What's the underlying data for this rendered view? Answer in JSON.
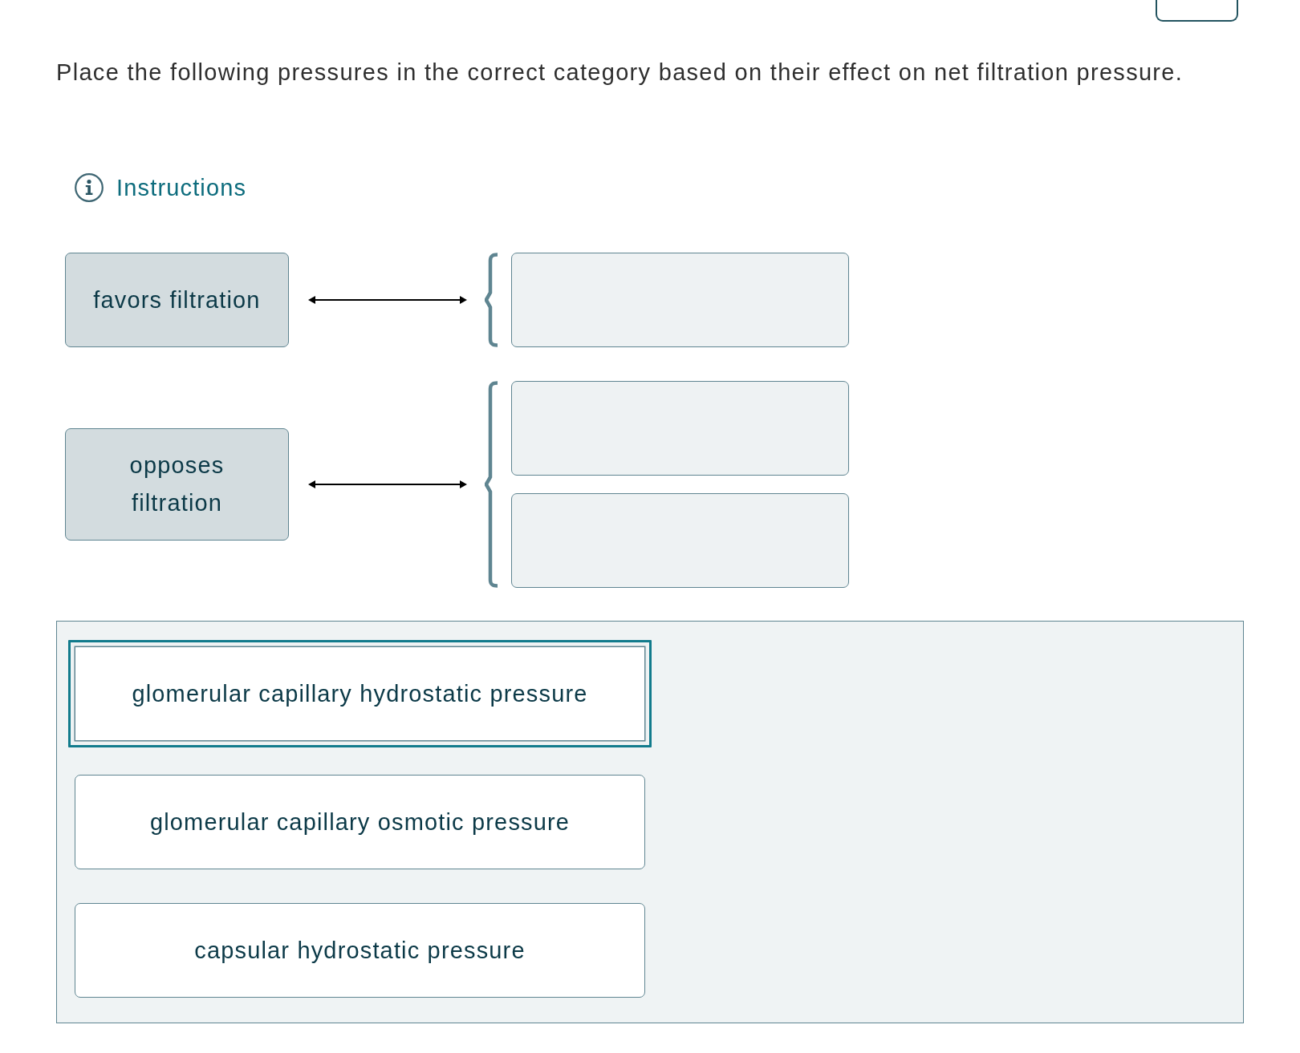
{
  "header": {
    "prompt": "Place the following pressures in the correct category based on their effect on net filtration pressure."
  },
  "instructions": {
    "label": "Instructions"
  },
  "categories": [
    {
      "label": "favors filtration",
      "drop_zones": [
        {
          "kind": "empty"
        }
      ]
    },
    {
      "label": "opposes filtration",
      "drop_zones": [
        {
          "kind": "empty"
        },
        {
          "kind": "empty"
        }
      ]
    }
  ],
  "answer_bank": {
    "items": [
      {
        "label": "glomerular capillary hydrostatic pressure",
        "focused": true
      },
      {
        "label": "glomerular capillary osmotic pressure",
        "focused": false
      },
      {
        "label": "capsular hydrostatic pressure",
        "focused": false
      }
    ]
  }
}
